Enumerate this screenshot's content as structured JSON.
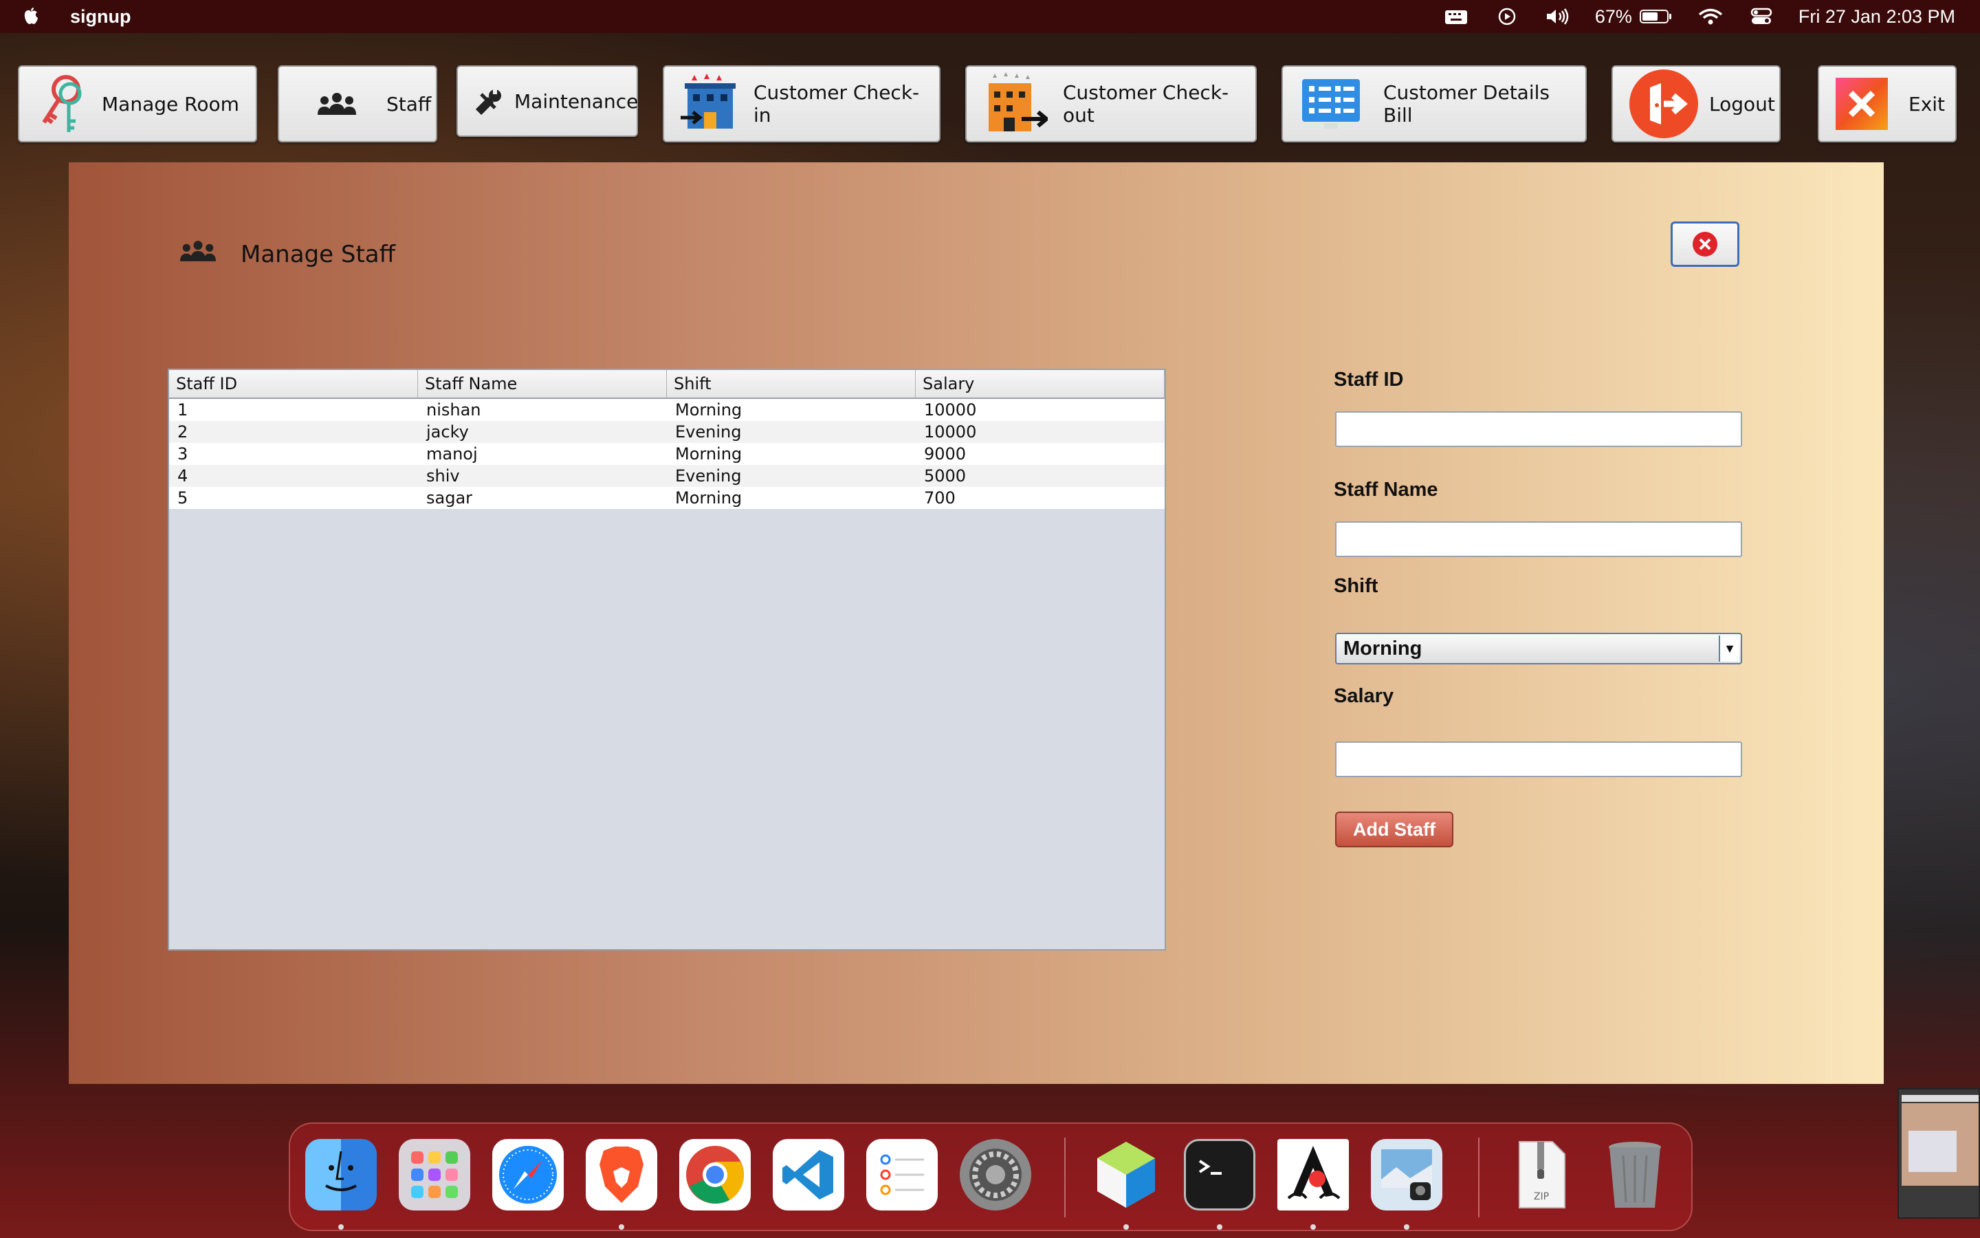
{
  "menubar": {
    "app_name": "signup",
    "battery": "67%",
    "datetime": "Fri 27 Jan  2:03 PM"
  },
  "toolbar": {
    "manage_room": "Manage Room",
    "staff": "Staff",
    "maintenance": "Maintenance",
    "checkin": "Customer Check-in",
    "checkout": "Customer Check-out",
    "details_bill": "Customer Details Bill",
    "logout": "Logout",
    "exit": "Exit"
  },
  "window": {
    "title": "Manage Staff"
  },
  "table": {
    "headers": [
      "Staff ID",
      "Staff Name",
      "Shift",
      "Salary"
    ],
    "rows": [
      [
        "1",
        "nishan",
        "Morning",
        "10000"
      ],
      [
        "2",
        "jacky",
        "Evening",
        "10000"
      ],
      [
        "3",
        "manoj",
        "Morning",
        "9000"
      ],
      [
        "4",
        "shiv",
        "Evening",
        "5000"
      ],
      [
        "5",
        "sagar",
        "Morning",
        "700"
      ]
    ]
  },
  "form": {
    "staff_id_label": "Staff ID",
    "staff_id_value": "",
    "staff_name_label": "Staff Name",
    "staff_name_value": "",
    "shift_label": "Shift",
    "shift_selected": "Morning",
    "salary_label": "Salary",
    "salary_value": "",
    "add_button": "Add Staff"
  },
  "colors": {
    "accent_close": "#e0222a",
    "add_button": "#c4503d"
  },
  "dock": {
    "icons": [
      "finder-icon",
      "launchpad-icon",
      "safari-icon",
      "brave-icon",
      "chrome-icon",
      "vscode-icon",
      "reminders-icon",
      "system-settings-icon",
      "netbeans-icon",
      "terminal-icon",
      "java-icon",
      "preview-icon",
      "zip-archive-icon",
      "trash-icon"
    ],
    "zip_label": "ZIP"
  }
}
